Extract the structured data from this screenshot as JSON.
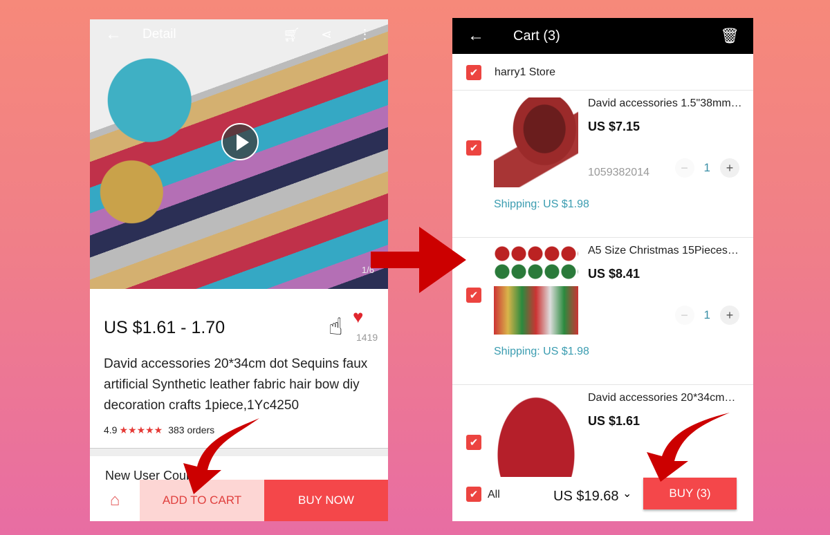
{
  "left": {
    "title": "Detail",
    "pager": "1/6",
    "price": "US $1.61 - 1.70",
    "fav_count": "1419",
    "product_title": "David accessories 20*34cm dot Sequins faux artificial Synthetic leather fabric hair bow diy decoration crafts 1piece,1Yc4250",
    "rating": "4.9",
    "stars": "★★★★★",
    "orders": "383 orders",
    "coupon": "New User Coupon",
    "add_to_cart": "ADD TO CART",
    "buy_now": "BUY NOW"
  },
  "right": {
    "title": "Cart (3)",
    "store": "harry1 Store",
    "items": [
      {
        "name": "David accessories 1.5\"38mm…",
        "price": "US $7.15",
        "sku": "1059382014",
        "qty": "1",
        "shipping": "Shipping: US $1.98"
      },
      {
        "name": "A5 Size Christmas 15Pieces…",
        "price": "US $8.41",
        "qty": "1",
        "shipping": "Shipping: US $1.98"
      },
      {
        "name": "David accessories 20*34cm…",
        "price": "US $1.61"
      }
    ],
    "all_label": "All",
    "total": "US $19.68",
    "buy": "BUY (3)"
  },
  "colors": {
    "accent": "#f4474a",
    "arrow": "#cc0000",
    "header": "#000000"
  }
}
